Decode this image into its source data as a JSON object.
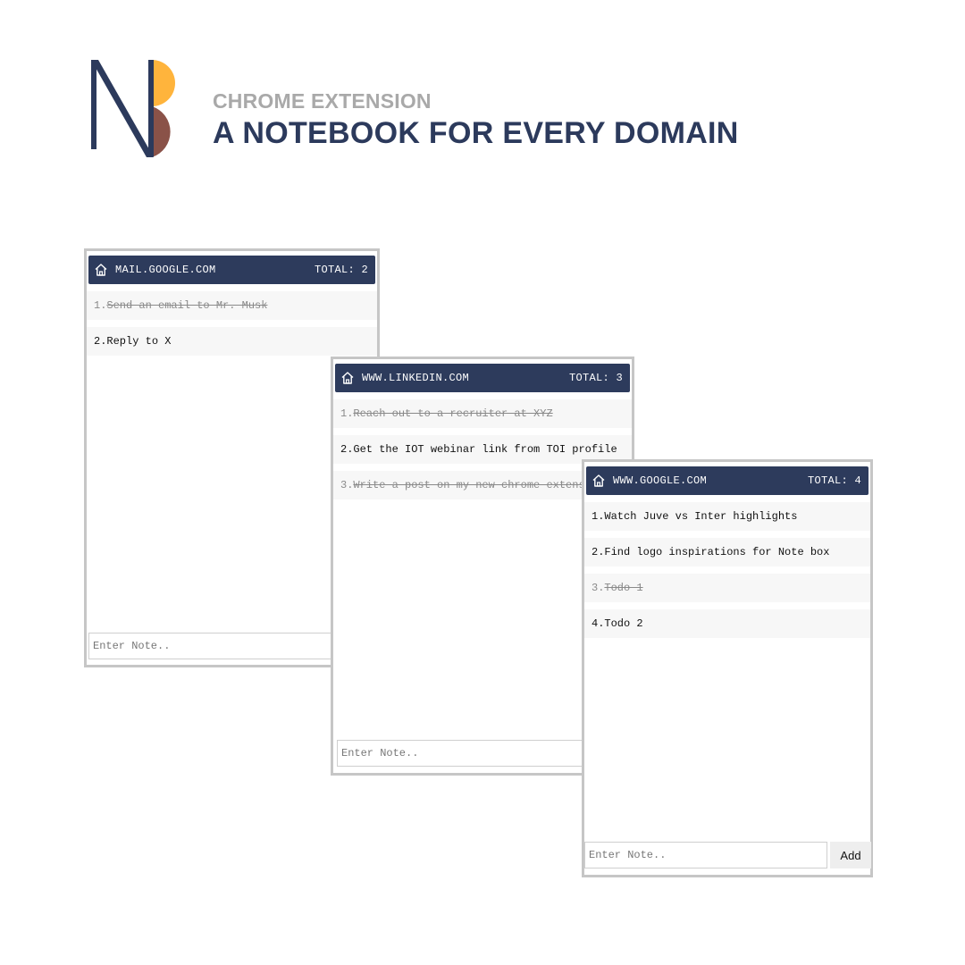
{
  "brand": {
    "subtitle": "CHROME EXTENSION",
    "title": "A NOTEBOOK FOR EVERY DOMAIN",
    "colors": {
      "navy": "#2c3a5c",
      "orange": "#ffb43c",
      "brown": "#8a5248",
      "gray": "#a9a9a9"
    }
  },
  "popups": [
    {
      "domain": "MAIL.GOOGLE.COM",
      "total_label": "TOTAL:",
      "total": "2",
      "notes": [
        {
          "num": "1.",
          "text": "Send an email to Mr. Musk",
          "done": true
        },
        {
          "num": "2.",
          "text": "Reply to X",
          "done": false
        }
      ],
      "input_placeholder": "Enter Note.."
    },
    {
      "domain": "WWW.LINKEDIN.COM",
      "total_label": "TOTAL:",
      "total": "3",
      "notes": [
        {
          "num": "1.",
          "text": "Reach out to a recruiter at XYZ",
          "done": true
        },
        {
          "num": "2.",
          "text": "Get the IOT webinar link from TOI profile",
          "done": false
        },
        {
          "num": "3.",
          "text": "Write a post on my new chrome extens",
          "done": true
        }
      ],
      "input_placeholder": "Enter Note.."
    },
    {
      "domain": "WWW.GOOGLE.COM",
      "total_label": "TOTAL:",
      "total": "4",
      "notes": [
        {
          "num": "1.",
          "text": "Watch Juve vs Inter highlights",
          "done": false
        },
        {
          "num": "2.",
          "text": "Find logo inspirations for Note box",
          "done": false
        },
        {
          "num": "3.",
          "text": "Todo 1",
          "done": true
        },
        {
          "num": "4.",
          "text": "Todo 2",
          "done": false
        }
      ],
      "input_placeholder": "Enter Note..",
      "add_label": "Add"
    }
  ]
}
